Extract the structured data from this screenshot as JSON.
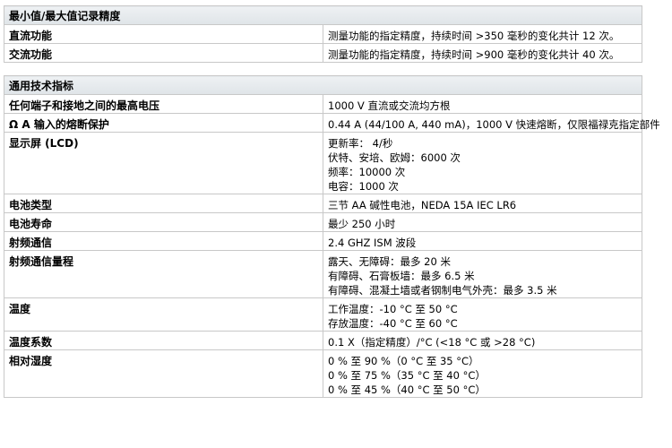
{
  "sections": [
    {
      "title": "最小值/最大值记录精度",
      "rows": [
        {
          "label": "直流功能",
          "lines": [
            "测量功能的指定精度，持续时间 >350 毫秒的变化共计 12 次。"
          ]
        },
        {
          "label": "交流功能",
          "lines": [
            "测量功能的指定精度，持续时间 >900 毫秒的变化共计 40 次。"
          ]
        }
      ]
    },
    {
      "title": "通用技术指标",
      "rows": [
        {
          "label": "任何端子和接地之间的最高电压",
          "lines": [
            "1000 V 直流或交流均方根"
          ]
        },
        {
          "label": "Ω A 输入的熔断保护",
          "lines": [
            "0.44 A (44/100 A, 440 mA)，1000 V 快速熔断，仅限福禄克指定部件"
          ]
        },
        {
          "label": "显示屏 (LCD)",
          "lines": [
            "更新率： 4/秒",
            "伏特、安培、欧姆：6000 次",
            "频率：10000 次",
            "电容：1000 次"
          ]
        },
        {
          "label": "电池类型",
          "lines": [
            "三节 AA 碱性电池，NEDA 15A IEC LR6"
          ]
        },
        {
          "label": "电池寿命",
          "lines": [
            "最少 250 小时"
          ]
        },
        {
          "label": "射频通信",
          "lines": [
            "2.4 GHZ ISM 波段"
          ]
        },
        {
          "label": "射频通信量程",
          "lines": [
            "露天、无障碍：最多 20 米",
            "有障碍、石膏板墙：最多 6.5 米",
            "有障碍、混凝土墙或者钢制电气外壳：最多 3.5 米"
          ]
        },
        {
          "label": "温度",
          "lines": [
            "工作温度：-10 °C 至 50 °C",
            "存放温度：-40 °C 至 60 °C"
          ]
        },
        {
          "label": "温度系数",
          "lines": [
            "0.1 X（指定精度）/°C (<18 °C 或 >28 °C)"
          ]
        },
        {
          "label": "相对湿度",
          "lines": [
            "0 % 至 90 %（0 °C 至 35 °C）",
            "0 % 至 75 %（35 °C 至 40 °C）",
            "0 % 至 45 %（40 °C 至 50 °C）"
          ]
        }
      ]
    }
  ]
}
